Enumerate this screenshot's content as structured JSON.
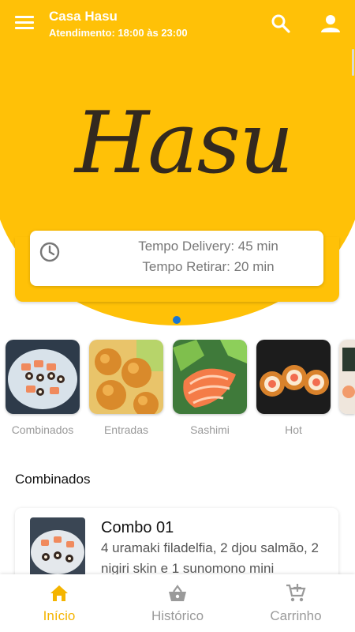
{
  "appbar": {
    "title": "Casa Hasu",
    "subtitle": "Atendimento: 18:00 às 23:00",
    "menu_icon": "hamburger-menu-icon",
    "search_icon": "search-icon",
    "user_icon": "user-account-icon"
  },
  "hero": {
    "logo_text": "Hasu",
    "carousel_active_dot": 1,
    "delivery_time": "Tempo Delivery: 45 min",
    "pickup_time": "Tempo Retirar: 20 min",
    "clock_icon": "clock-icon"
  },
  "categories": [
    {
      "label": "Combinados",
      "image": "sushi-platter"
    },
    {
      "label": "Entradas",
      "image": "fried-balls"
    },
    {
      "label": "Sashimi",
      "image": "salmon-sashimi"
    },
    {
      "label": "Hot",
      "image": "hot-roll"
    },
    {
      "label": "",
      "image": "partial-category"
    }
  ],
  "section": {
    "title": "Combinados"
  },
  "products": [
    {
      "name": "Combo 01",
      "description": "4 uramaki filadelfia, 2 djou salmão, 2 nigiri skin e 1 sunomono mini"
    }
  ],
  "bottom_nav": [
    {
      "label": "Início",
      "icon": "home-icon",
      "active": true
    },
    {
      "label": "Histórico",
      "icon": "basket-icon",
      "active": false
    },
    {
      "label": "Carrinho",
      "icon": "add-to-cart-icon",
      "active": false
    }
  ],
  "colors": {
    "primary": "#FFC107",
    "active_nav": "#F4B400",
    "dot": "#1976D2"
  }
}
